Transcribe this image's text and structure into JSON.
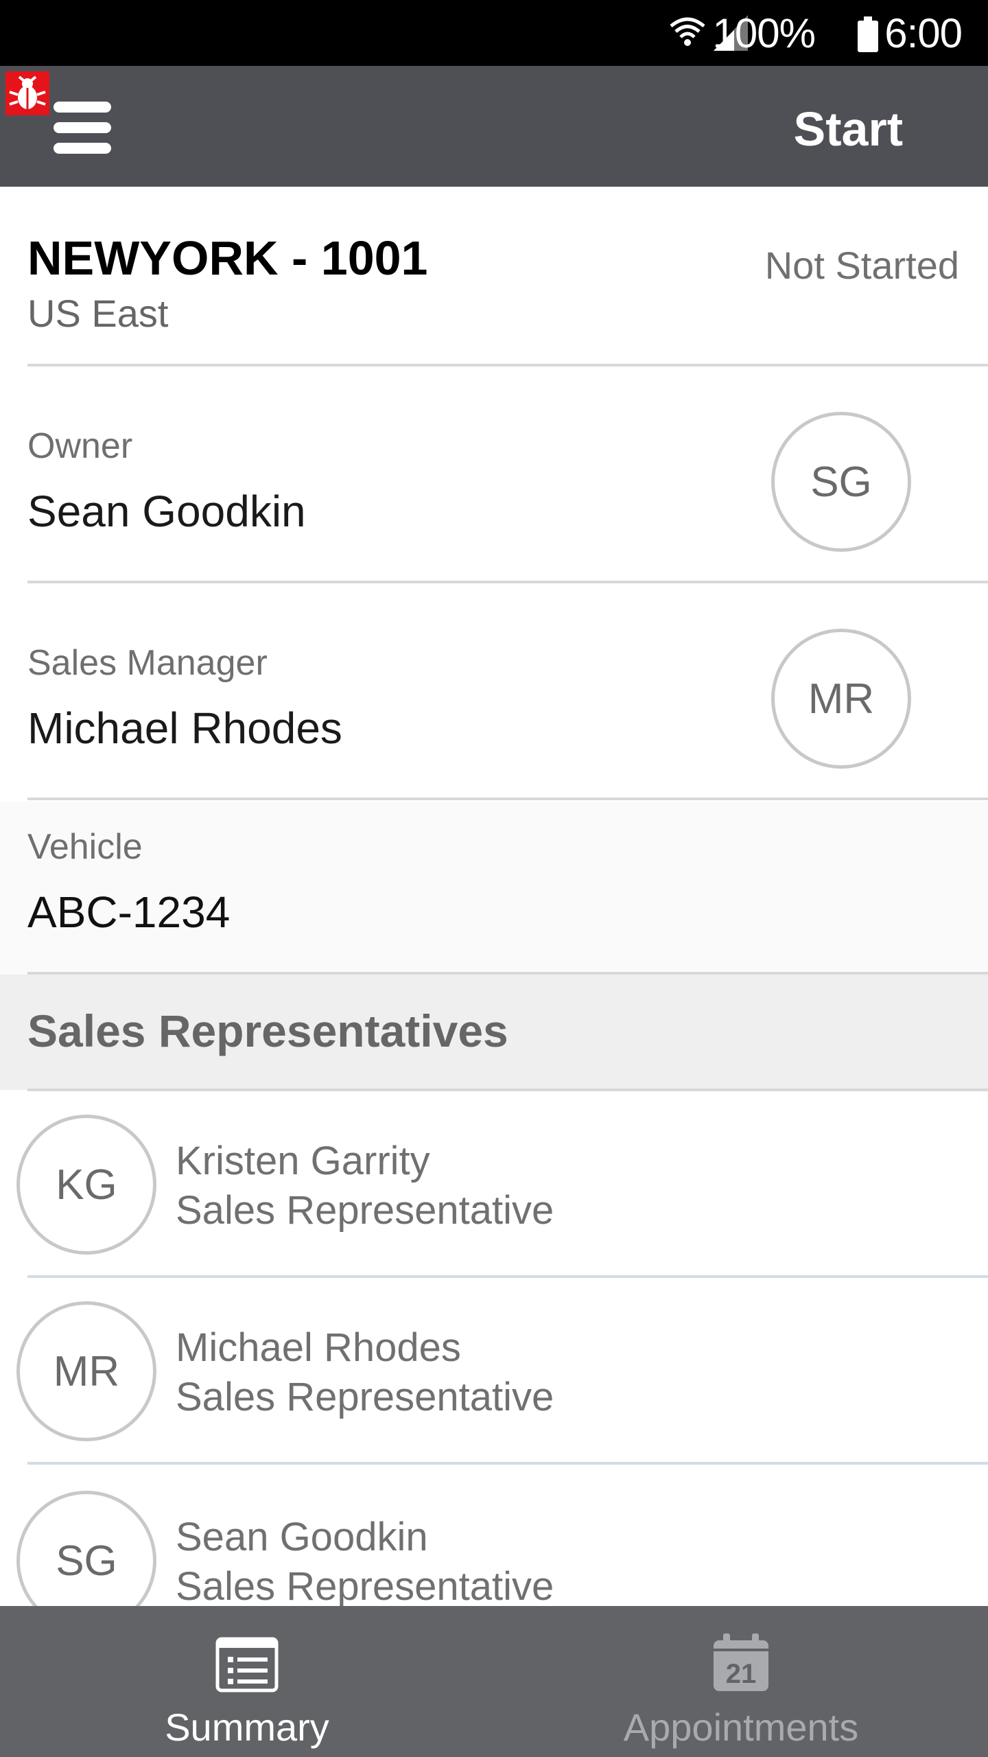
{
  "status_bar": {
    "battery": "100%",
    "time": "6:00"
  },
  "app_bar": {
    "title": "Start"
  },
  "store": {
    "name": "NEWYORK - 1001",
    "region": "US East",
    "status": "Not Started"
  },
  "owner": {
    "label": "Owner",
    "name": "Sean Goodkin",
    "initials": "SG"
  },
  "sales_manager": {
    "label": "Sales Manager",
    "name": "Michael Rhodes",
    "initials": "MR"
  },
  "vehicle": {
    "label": "Vehicle",
    "value": "ABC-1234"
  },
  "sales_reps": {
    "title": "Sales Representatives",
    "items": [
      {
        "initials": "KG",
        "name": "Kristen Garrity",
        "role": "Sales Representative"
      },
      {
        "initials": "MR",
        "name": "Michael Rhodes",
        "role": "Sales Representative"
      },
      {
        "initials": "SG",
        "name": "Sean Goodkin",
        "role": "Sales Representative"
      }
    ]
  },
  "tabs": [
    {
      "label": "Summary",
      "icon": "list-icon",
      "active": true,
      "color": "#ffffff"
    },
    {
      "label": "Appointments",
      "icon": "calendar-icon",
      "active": false,
      "color": "#a9aaae"
    }
  ],
  "calendar_day": "21",
  "colors": {
    "app_bar": "#4f5056",
    "tab_bar": "#626367",
    "section_bg": "#efefef"
  }
}
